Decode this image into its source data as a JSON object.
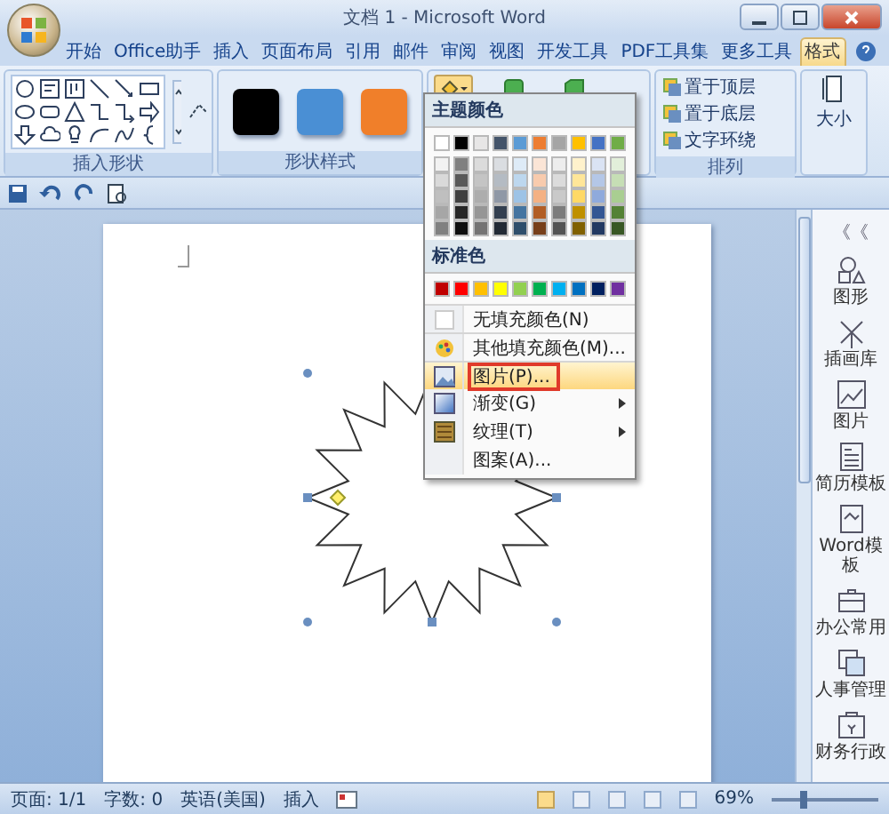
{
  "window": {
    "title": "文档 1 - Microsoft Word"
  },
  "ribbon_tabs": [
    {
      "label": "开始",
      "selected": false
    },
    {
      "label": "Office助手",
      "selected": false
    },
    {
      "label": "插入",
      "selected": false
    },
    {
      "label": "页面布局",
      "selected": false
    },
    {
      "label": "引用",
      "selected": false
    },
    {
      "label": "邮件",
      "selected": false
    },
    {
      "label": "审阅",
      "selected": false
    },
    {
      "label": "视图",
      "selected": false
    },
    {
      "label": "开发工具",
      "selected": false
    },
    {
      "label": "PDF工具集",
      "selected": false
    },
    {
      "label": "更多工具",
      "selected": false
    },
    {
      "label": "格式",
      "selected": true
    }
  ],
  "ribbon_groups": {
    "insert_shapes": {
      "label": "插入形状"
    },
    "shape_styles": {
      "label": "形状样式",
      "swatches": [
        {
          "color": "#000000"
        },
        {
          "color": "#4a8fd4"
        },
        {
          "color": "#f07f2a"
        }
      ]
    },
    "arrange": {
      "label": "排列",
      "buttons": [
        {
          "label": "置于顶层"
        },
        {
          "label": "置于底层"
        },
        {
          "label": "文字环绕"
        }
      ]
    },
    "size": {
      "label": "大小"
    }
  },
  "fill_menu": {
    "theme_header": "主题颜色",
    "theme_colors": [
      {
        "color": "#ffffff"
      },
      {
        "color": "#000000"
      },
      {
        "color": "#e7e6e6"
      },
      {
        "color": "#44546a"
      },
      {
        "color": "#5b9bd5"
      },
      {
        "color": "#ed7d31"
      },
      {
        "color": "#a5a5a5"
      },
      {
        "color": "#ffc000"
      },
      {
        "color": "#4472c4"
      },
      {
        "color": "#70ad47"
      }
    ],
    "standard_header": "标准色",
    "standard_colors": [
      {
        "color": "#c00000"
      },
      {
        "color": "#ff0000"
      },
      {
        "color": "#ffc000"
      },
      {
        "color": "#ffff00"
      },
      {
        "color": "#92d050"
      },
      {
        "color": "#00b050"
      },
      {
        "color": "#00b0f0"
      },
      {
        "color": "#0070c0"
      },
      {
        "color": "#002060"
      },
      {
        "color": "#7030a0"
      }
    ],
    "items": [
      {
        "kind": "no-fill",
        "label": "无填充颜色(N)",
        "highlighted": false,
        "annotated": false,
        "submenu": false
      },
      {
        "kind": "more-colors",
        "label": "其他填充颜色(M)...",
        "highlighted": false,
        "annotated": false,
        "submenu": false
      },
      {
        "kind": "picture",
        "label": "图片(P)...",
        "highlighted": true,
        "annotated": true,
        "submenu": false
      },
      {
        "kind": "gradient",
        "label": "渐变(G)",
        "highlighted": false,
        "annotated": false,
        "submenu": true
      },
      {
        "kind": "texture",
        "label": "纹理(T)",
        "highlighted": false,
        "annotated": false,
        "submenu": true
      },
      {
        "kind": "pattern",
        "label": "图案(A)...",
        "highlighted": false,
        "annotated": false,
        "submenu": false
      }
    ]
  },
  "side_panel": {
    "collapse": "《《",
    "items": [
      {
        "kind": "shapes",
        "label": "图形"
      },
      {
        "kind": "clipart",
        "label": "插画库"
      },
      {
        "kind": "picture",
        "label": "图片"
      },
      {
        "kind": "resume",
        "label": "简历模板"
      },
      {
        "kind": "template",
        "label": "Word模板"
      },
      {
        "kind": "office",
        "label": "办公常用"
      },
      {
        "kind": "hr",
        "label": "人事管理"
      },
      {
        "kind": "finance",
        "label": "财务行政"
      }
    ]
  },
  "status_bar": {
    "items": [
      "页面: 1/1",
      "字数: 0",
      "英语(美国)",
      "插入"
    ],
    "view_modes": [
      {
        "selected": true
      },
      {
        "selected": false
      },
      {
        "selected": false
      },
      {
        "selected": false
      },
      {
        "selected": false
      }
    ],
    "zoom": "69%",
    "zoom_slider": {
      "level": 0.3
    }
  }
}
